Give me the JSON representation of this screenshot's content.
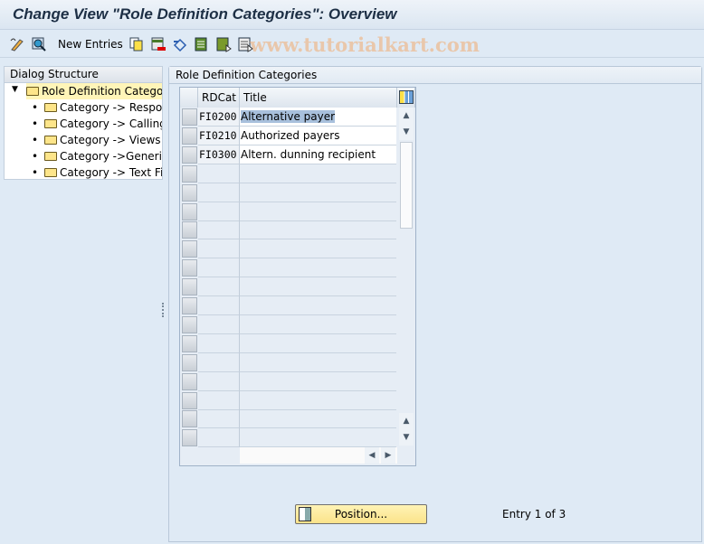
{
  "window": {
    "title": "Change View \"Role Definition Categories\": Overview"
  },
  "toolbar": {
    "new_entries": "New Entries",
    "icons": [
      "display-change-icon",
      "find-icon",
      "copy-icon",
      "delete-icon",
      "undo-icon",
      "select-all-icon",
      "select-block-icon",
      "deselect-all-icon"
    ],
    "watermark": "www.tutorialkart.com"
  },
  "dialog_structure": {
    "title": "Dialog Structure",
    "root": "Role Definition Categories",
    "children": [
      "Category -> Responsibilities",
      "Category -> Calling Applications",
      "Category -> Views",
      "Category ->Generic Data",
      "Category -> Text Fields"
    ],
    "visible_children": [
      "Category -> Respons",
      "Category -> Calling A",
      "Category -> Views",
      "Category ->Generic I",
      "Category -> Text Fie"
    ],
    "root_visible": "Role Definition Categorie"
  },
  "panel": {
    "title": "Role Definition Categories"
  },
  "table": {
    "columns": [
      "RDCat",
      "Title"
    ],
    "rows": [
      {
        "rdcat": "FI0200",
        "title": "Alternative payer"
      },
      {
        "rdcat": "FI0210",
        "title": "Authorized payers"
      },
      {
        "rdcat": "FI0300",
        "title": "Altern. dunning recipient"
      }
    ],
    "empty_rows": 15
  },
  "footer": {
    "position_button": "Position...",
    "entry_info": "Entry 1 of 3"
  }
}
